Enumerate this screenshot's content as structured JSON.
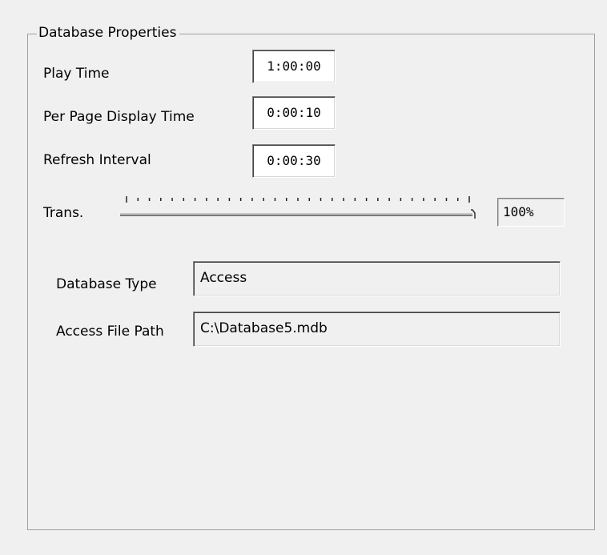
{
  "group": {
    "title": "Database Properties"
  },
  "play_time": {
    "label": "Play Time",
    "value": "1:00:00"
  },
  "per_page_display_time": {
    "label": "Per Page Display Time",
    "value": "0:00:10"
  },
  "refresh_interval": {
    "label": "Refresh Interval",
    "value": "0:00:30"
  },
  "transparency": {
    "label": "Trans.",
    "value_text": "100%",
    "value_fraction": 1.0,
    "tick_count": 31
  },
  "database_type": {
    "label": "Database Type",
    "value": "Access"
  },
  "access_file_path": {
    "label": "Access File Path",
    "value": "C:\\Database5.mdb"
  }
}
